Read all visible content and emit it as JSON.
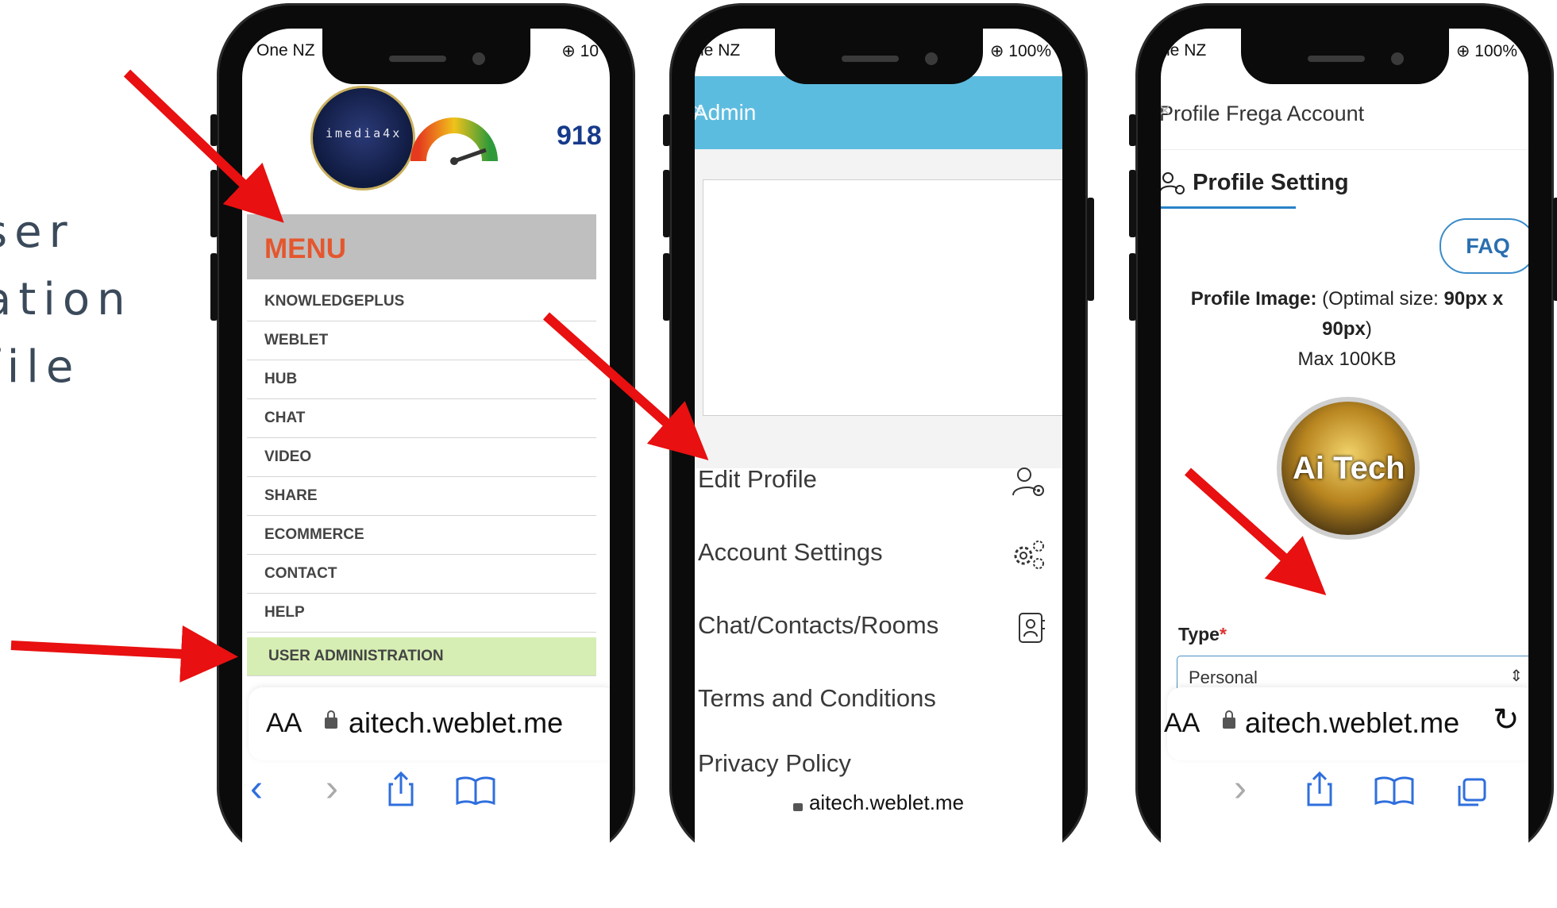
{
  "caption": {
    "lines": [
      "ser",
      "ation",
      "file"
    ]
  },
  "phone1": {
    "carrier": "One NZ",
    "battery": "⊕ 10",
    "logo_text": "imedia4x",
    "score": "918",
    "menu_title": "MENU",
    "menu_items": [
      "KNOWLEDGEPLUS",
      "WEBLET",
      "HUB",
      "CHAT",
      "VIDEO",
      "SHARE",
      "ECOMMERCE",
      "CONTACT",
      "HELP"
    ],
    "active_item": "USER ADMINISTRATION",
    "text_size": "AA",
    "url": "aitech.weblet.me"
  },
  "phone2": {
    "carrier": "ne NZ",
    "battery": "⊕ 100%",
    "title": "Admin",
    "close": "×",
    "options": [
      {
        "label": "Edit Profile",
        "icon": "user-gear-icon"
      },
      {
        "label": "Account Settings",
        "icon": "gears-icon"
      },
      {
        "label": "Chat/Contacts/Rooms",
        "icon": "contacts-book-icon"
      },
      {
        "label": "Terms and Conditions",
        "icon": ""
      },
      {
        "label": "Privacy Policy",
        "icon": ""
      }
    ],
    "url": "aitech.weblet.me"
  },
  "phone3": {
    "carrier": "ne NZ",
    "battery": "⊕ 100%",
    "title": "Profile Frega Account",
    "close": "×",
    "tab": "Profile Setting",
    "faq": "FAQ",
    "profile_image_label": "Profile Image:",
    "profile_image_hint": "(Optimal size:",
    "profile_image_size": "90px x 90px",
    "profile_image_close": ")",
    "max_size": "Max 100KB",
    "avatar_text": "Ai Tech",
    "type_label": "Type",
    "required_mark": "*",
    "type_value": "Personal",
    "text_size": "AA",
    "url": "aitech.weblet.me"
  },
  "colors": {
    "menu_title": "#e4572e",
    "active_item_bg": "#d6eeb3",
    "admin_bar": "#5cbcdf",
    "ios_blue": "#2f6fdd",
    "arrow": "#e81010"
  }
}
